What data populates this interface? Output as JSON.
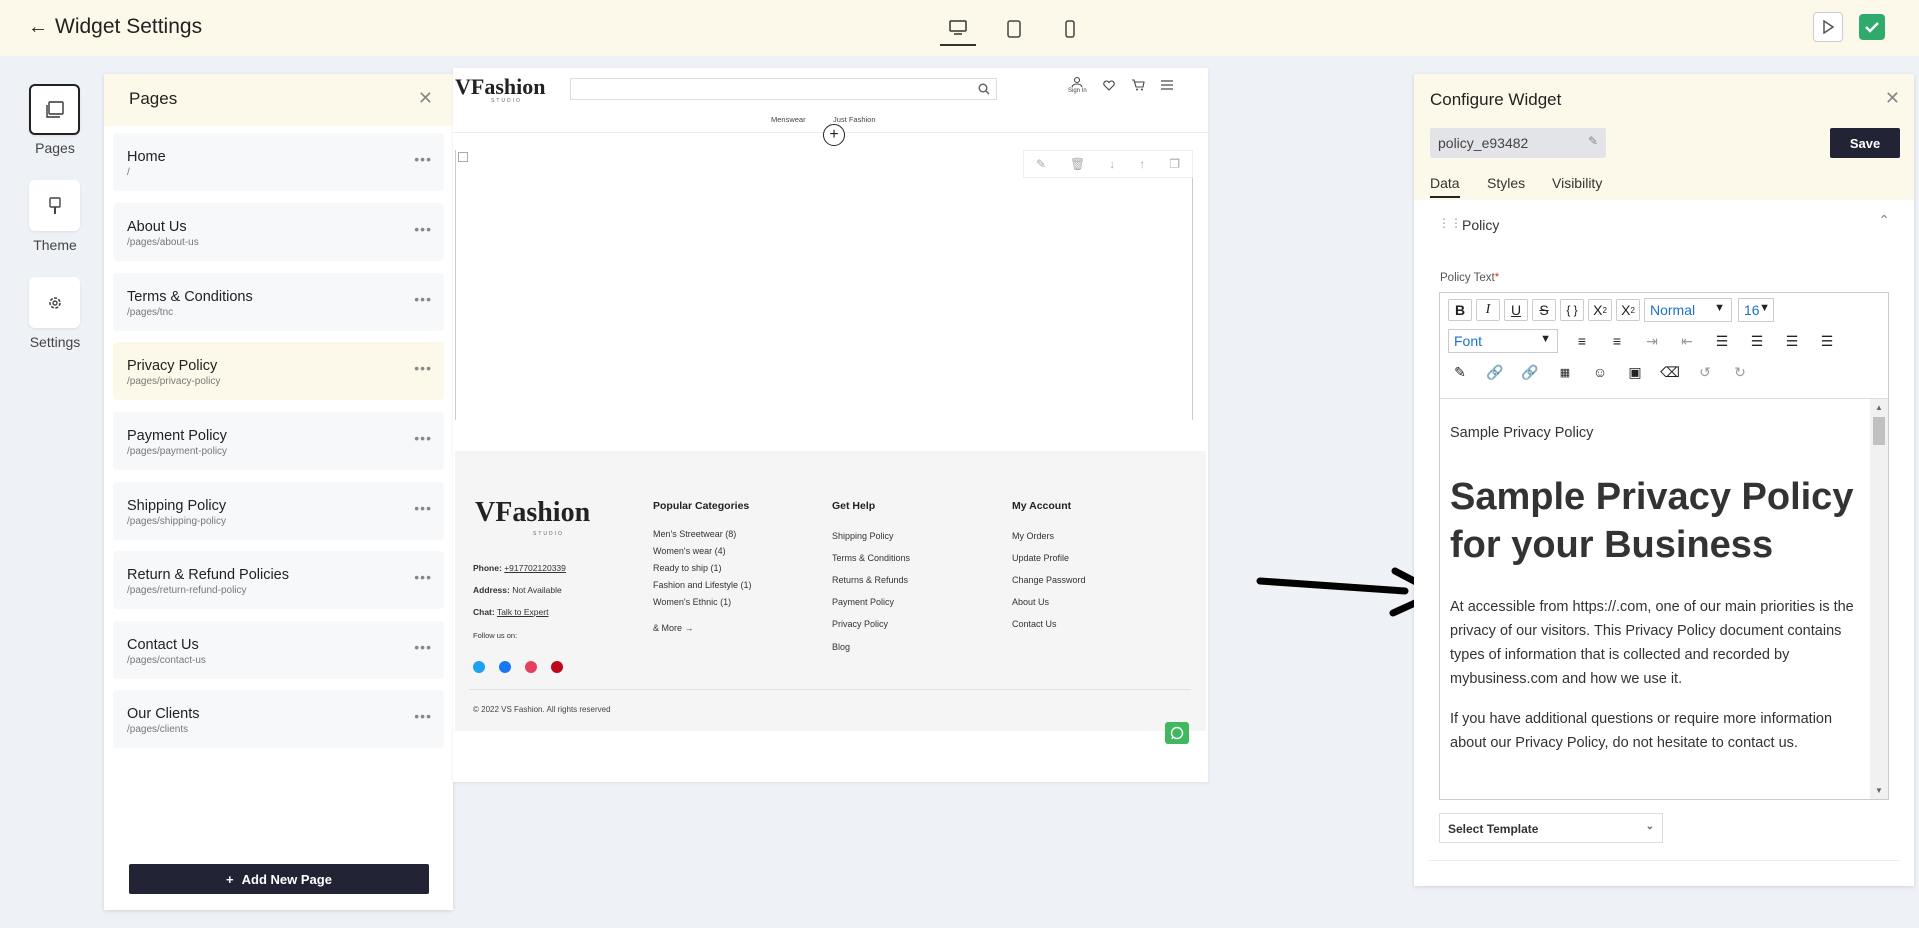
{
  "header": {
    "title": "Widget Settings"
  },
  "rail": {
    "items": [
      {
        "label": "Pages",
        "icon": "pages-icon"
      },
      {
        "label": "Theme",
        "icon": "brush-icon"
      },
      {
        "label": "Settings",
        "icon": "gear-icon"
      }
    ]
  },
  "pages_panel": {
    "title": "Pages",
    "items": [
      {
        "name": "Home",
        "path": "/"
      },
      {
        "name": "About Us",
        "path": "/pages/about-us"
      },
      {
        "name": "Terms & Conditions",
        "path": "/pages/tnc"
      },
      {
        "name": "Privacy Policy",
        "path": "/pages/privacy-policy"
      },
      {
        "name": "Payment Policy",
        "path": "/pages/payment-policy"
      },
      {
        "name": "Shipping Policy",
        "path": "/pages/shipping-policy"
      },
      {
        "name": "Return & Refund Policies",
        "path": "/pages/return-refund-policy"
      },
      {
        "name": "Contact Us",
        "path": "/pages/contact-us"
      },
      {
        "name": "Our Clients",
        "path": "/pages/clients"
      }
    ],
    "add_label": "Add New Page"
  },
  "preview": {
    "logo": "VFashion",
    "logo_sub": "STUDIO",
    "sign_in": "Sign In",
    "nav": [
      "Menswear",
      "Just Fashion"
    ],
    "footer": {
      "phone_label": "Phone:",
      "phone": "+917702120339",
      "address_label": "Address:",
      "address": "Not Available",
      "chat_label": "Chat:",
      "chat": "Talk to Expert",
      "follow": "Follow us on:",
      "copyright": "© 2022 VS Fashion. All rights reserved",
      "col1_title": "Popular Categories",
      "col1_items": [
        "Men's Streetwear (8)",
        "Women's wear (4)",
        "Ready to ship (1)",
        "Fashion and Lifestyle (1)",
        "Women's Ethnic (1)"
      ],
      "col1_more": "& More",
      "col2_title": "Get Help",
      "col2_items": [
        "Shipping Policy",
        "Terms & Conditions",
        "Returns & Refunds",
        "Payment Policy",
        "Privacy Policy",
        "Blog"
      ],
      "col3_title": "My Account",
      "col3_items": [
        "My Orders",
        "Update Profile",
        "Change Password",
        "About Us",
        "Contact Us"
      ]
    }
  },
  "configure": {
    "title": "Configure Widget",
    "widget_name": "policy_e93482",
    "save_label": "Save",
    "tabs": [
      "Data",
      "Styles",
      "Visibility"
    ],
    "section": "Policy",
    "field_label": "Policy Text",
    "required_mark": "*",
    "toolbar": {
      "heading_select": "Normal",
      "size_select": "16",
      "font_select": "Font"
    },
    "content": {
      "p1": "Sample Privacy Policy",
      "h1": "Sample Privacy Policy for your Business",
      "p2": "At  accessible from https://.com, one of our main priorities is the privacy of our visitors. This Privacy Policy document contains types of information that is collected and recorded by mybusiness.com and how we use it.",
      "p3": "If you have additional questions or require more information about our Privacy Policy, do not hesitate to contact us."
    },
    "template_placeholder": "Select Template"
  }
}
